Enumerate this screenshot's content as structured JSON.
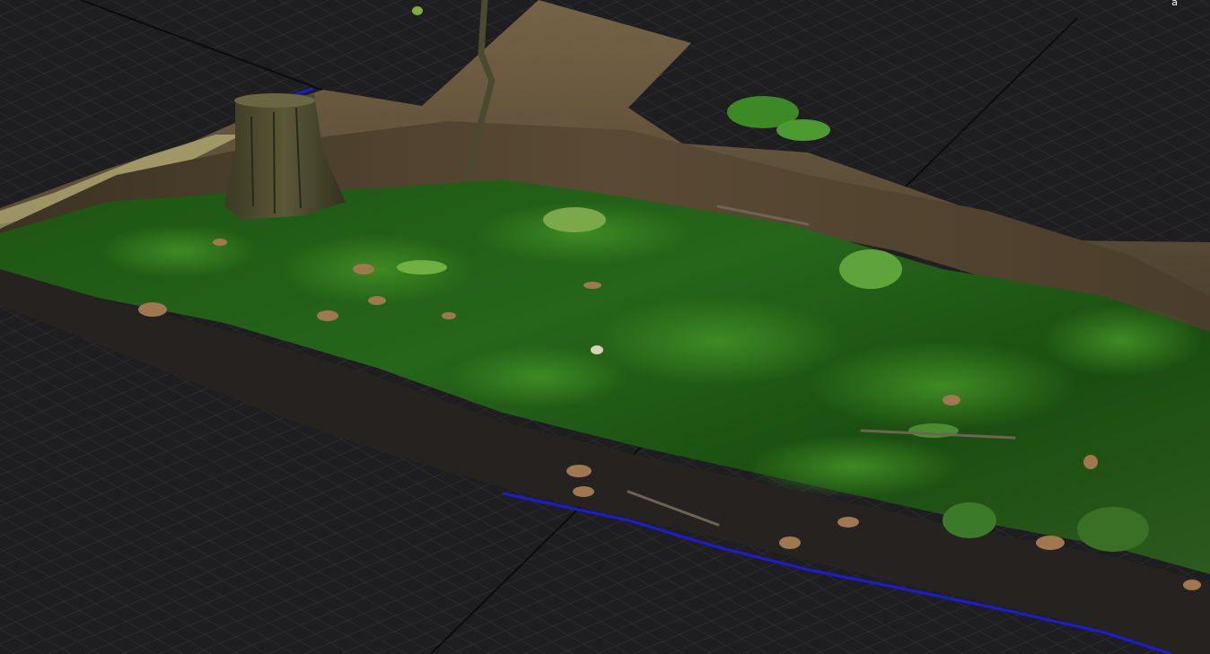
{
  "viewport": {
    "axis_indicator": "a"
  },
  "colors": {
    "background": "#1d1d1e",
    "grid_line": "#3b3b3d",
    "grid_axis": "#0b0b0c",
    "moss_dark": "#123a0c",
    "moss_mid": "#1f5a14",
    "moss_light": "#2f7a1c",
    "soil": "#2a2520",
    "leaf_litter": "#5a4630",
    "stump": "#4a4a2e",
    "mesh_edge_blue": "#1b1bd6",
    "skirt_tan": "#6b5a3e"
  },
  "icons": [
    "axis-gizmo-icon"
  ]
}
